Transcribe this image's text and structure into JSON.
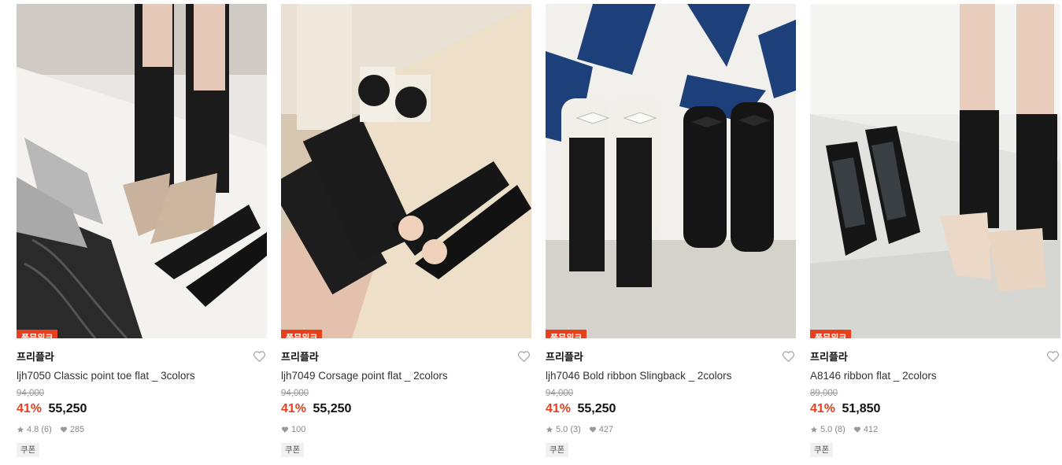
{
  "products": [
    {
      "badge": "풀문위크",
      "brand": "프리플라",
      "title": "ljh7050 Classic point toe flat _ 3colors",
      "original_price": "94,000",
      "discount": "41%",
      "price": "55,250",
      "rating": "4.8",
      "reviews": "(6)",
      "likes": "285",
      "coupon": "쿠폰"
    },
    {
      "badge": "풀문위크",
      "brand": "프리플라",
      "title": "ljh7049 Corsage point flat _ 2colors",
      "original_price": "94,000",
      "discount": "41%",
      "price": "55,250",
      "likes": "100",
      "coupon": "쿠폰"
    },
    {
      "badge": "풀문위크",
      "brand": "프리플라",
      "title": "ljh7046 Bold ribbon Slingback _ 2colors",
      "original_price": "94,000",
      "discount": "41%",
      "price": "55,250",
      "rating": "5.0",
      "reviews": "(3)",
      "likes": "427",
      "coupon": "쿠폰"
    },
    {
      "badge": "풀문위크",
      "brand": "프리플라",
      "title": "A8146 ribbon flat _ 2colors",
      "original_price": "89,000",
      "discount": "41%",
      "price": "51,850",
      "rating": "5.0",
      "reviews": "(8)",
      "likes": "412",
      "coupon": "쿠폰"
    }
  ],
  "colors": {
    "accent": "#e8401c",
    "text": "#111111",
    "muted": "#999999"
  },
  "icons": [
    "heart-outline-icon",
    "star-icon",
    "heart-filled-icon"
  ]
}
